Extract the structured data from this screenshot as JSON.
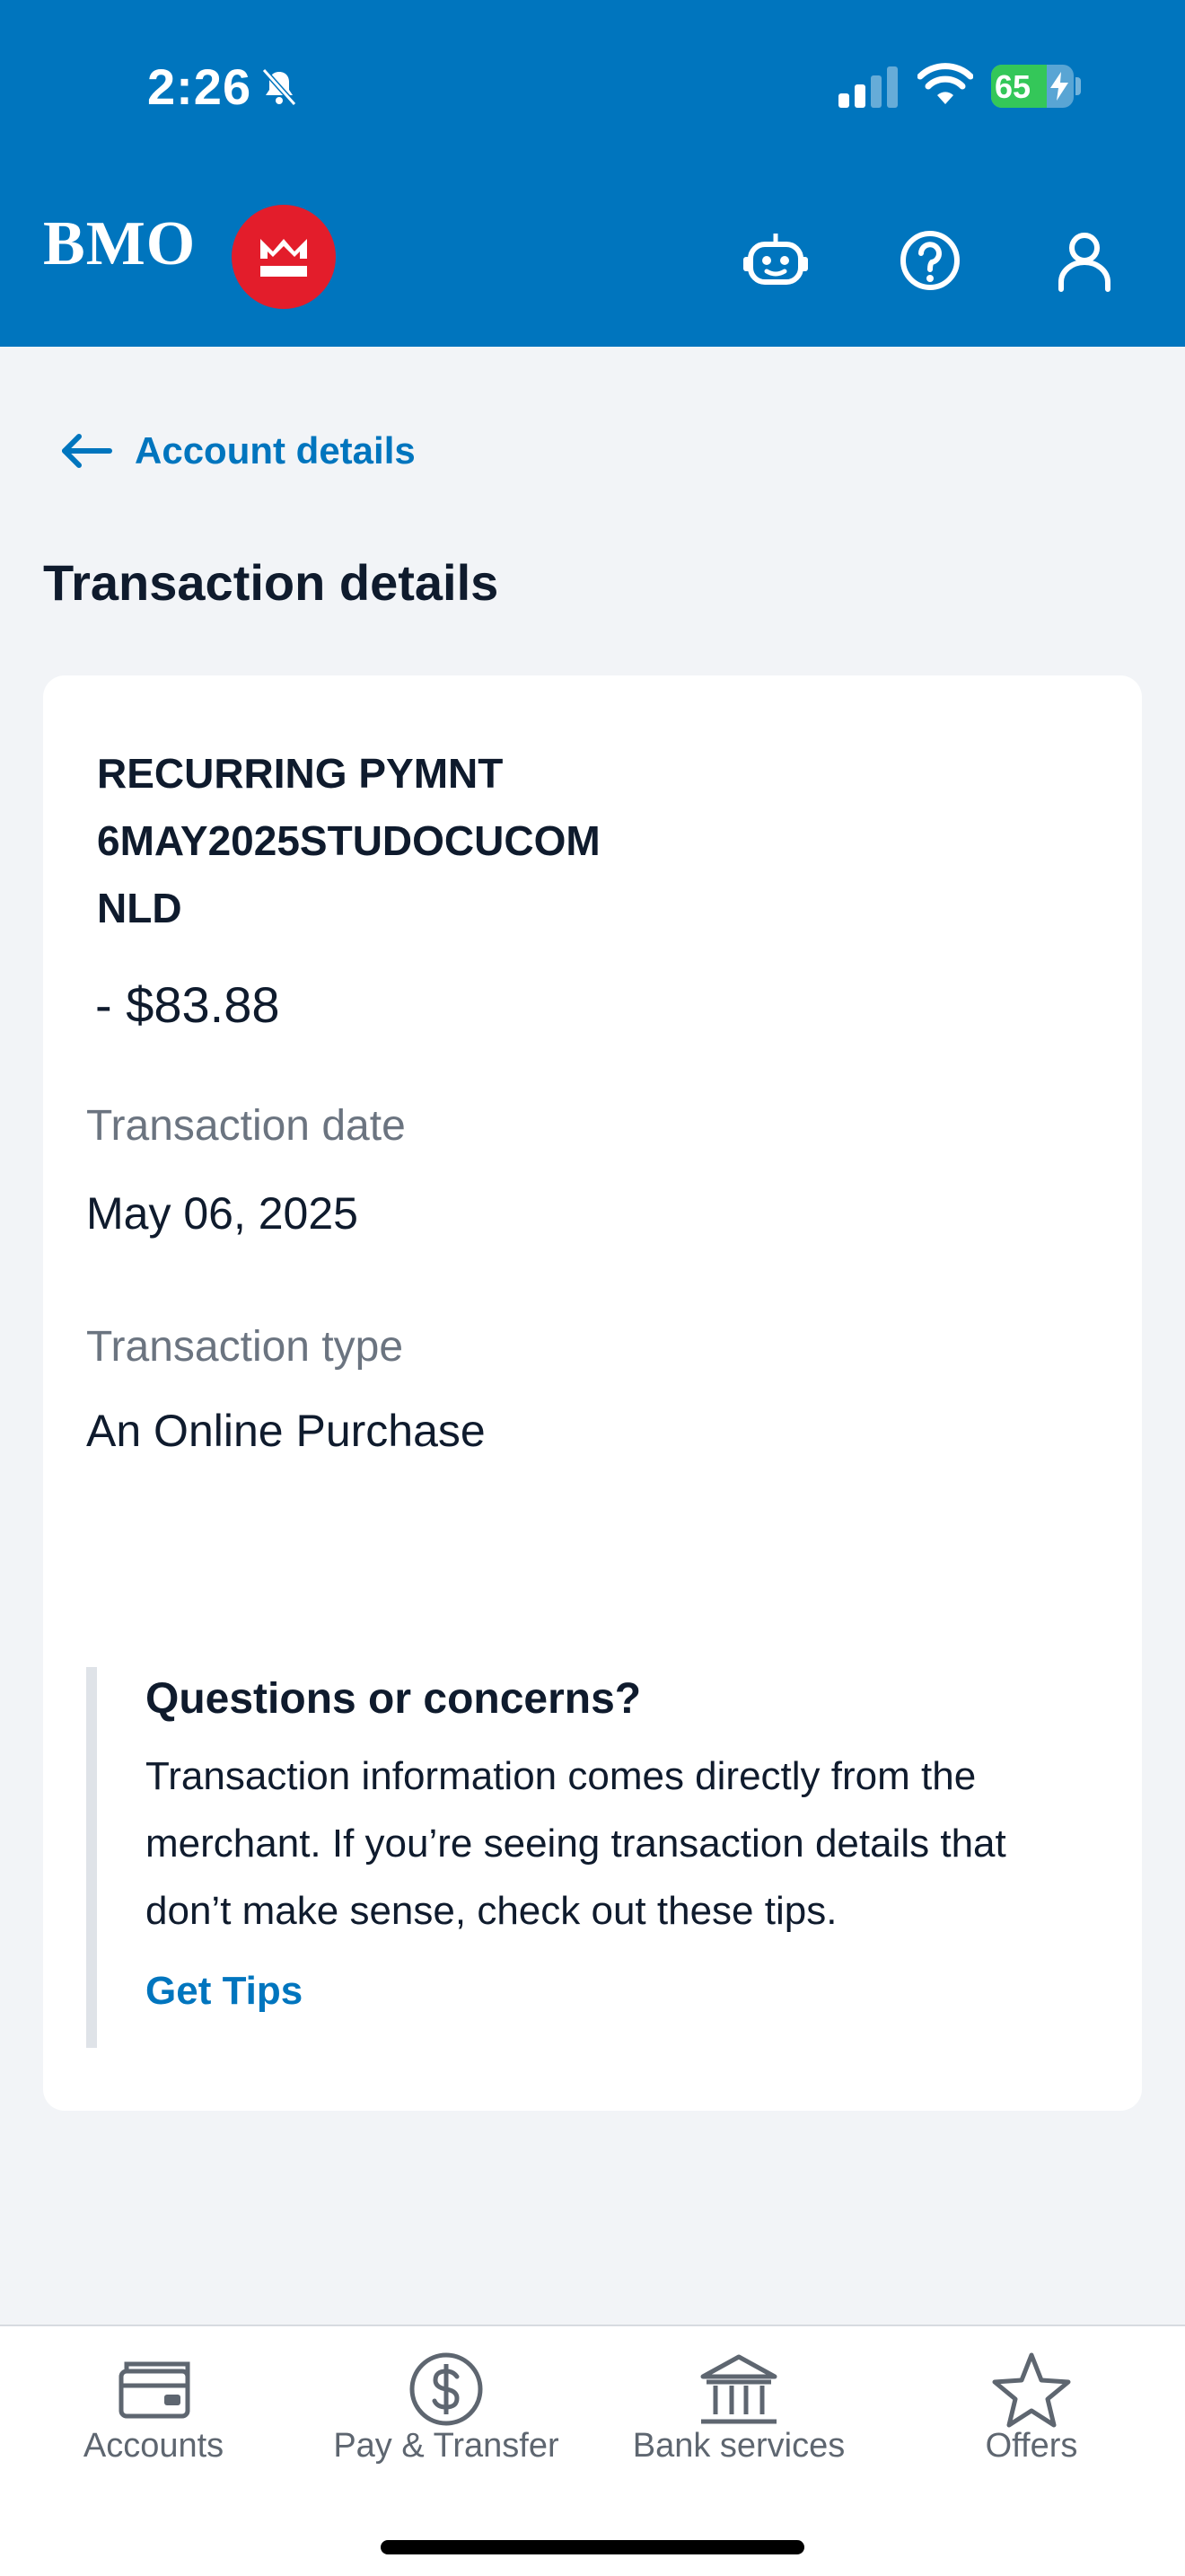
{
  "status_bar": {
    "time": "2:26",
    "battery": "65"
  },
  "header": {
    "brand": "BMO"
  },
  "nav": {
    "back_label": "Account details"
  },
  "page": {
    "title": "Transaction details"
  },
  "transaction": {
    "merchant": "RECURRING PYMNT\n6MAY2025STUDOCUCOM\nNLD",
    "amount": "- $83.88",
    "date_label": "Transaction date",
    "date_value": "May 06, 2025",
    "type_label": "Transaction type",
    "type_value": "An Online Purchase"
  },
  "notice": {
    "title": "Questions or concerns?",
    "body": "Transaction information comes directly from the merchant. If you’re seeing transaction details that don’t make sense, check out these tips.",
    "link": "Get Tips"
  },
  "tabs": [
    {
      "label": "Accounts",
      "icon": "accounts-icon"
    },
    {
      "label": "Pay & Transfer",
      "icon": "dollar-icon"
    },
    {
      "label": "Bank services",
      "icon": "bank-icon"
    },
    {
      "label": "Offers",
      "icon": "star-icon"
    }
  ],
  "colors": {
    "brand_blue": "#0075be",
    "brand_red": "#e31d2b",
    "battery_green": "#34c759"
  }
}
